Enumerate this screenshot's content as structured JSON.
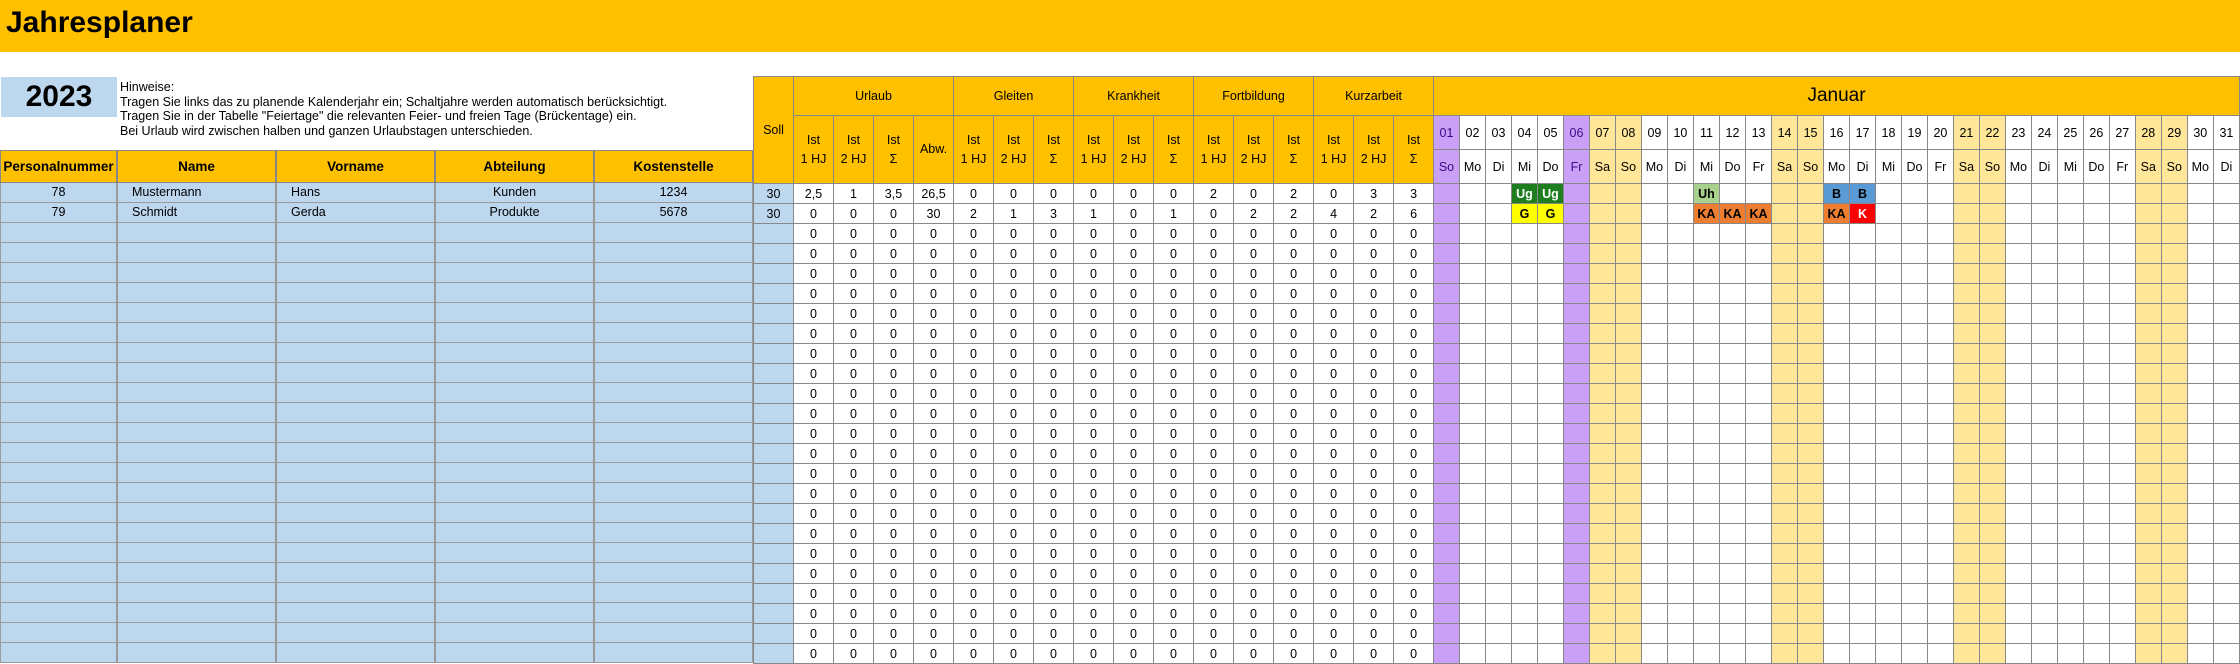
{
  "title": "Jahresplaner",
  "year": "2023",
  "notes": [
    "Hinweise:",
    "Tragen Sie links das zu planende Kalenderjahr ein; Schaltjahre werden automatisch berücksichtigt.",
    "Tragen Sie in der Tabelle \"Feiertage\" die relevanten Feier- und freien Tage (Brückentage) ein.",
    "Bei Urlaub wird zwischen halben und ganzen Urlaubstagen unterschieden."
  ],
  "employee_headers": [
    "Personalnummer",
    "Name",
    "Vorname",
    "Abteilung",
    "Kostenstelle"
  ],
  "employees": [
    {
      "nr": "78",
      "name": "Mustermann",
      "vorname": "Hans",
      "abteilung": "Kunden",
      "kst": "1234"
    },
    {
      "nr": "79",
      "name": "Schmidt",
      "vorname": "Gerda",
      "abteilung": "Produkte",
      "kst": "5678"
    }
  ],
  "total_rows": 24,
  "soll_label": "Soll",
  "groups": [
    "Urlaub",
    "Gleiten",
    "Krankheit",
    "Fortbildung",
    "Kurzarbeit"
  ],
  "urlaub_subs": [
    "Ist\n1 HJ",
    "Ist\n2 HJ",
    "Ist\nΣ",
    "Abw."
  ],
  "other_subs": [
    "Ist\n1 HJ",
    "Ist\n2 HJ",
    "Ist\nΣ"
  ],
  "stats_rows": [
    {
      "soll": "30",
      "values": [
        "2,5",
        "1",
        "3,5",
        "26,5",
        "0",
        "0",
        "0",
        "0",
        "0",
        "0",
        "2",
        "0",
        "2",
        "0",
        "3",
        "3"
      ]
    },
    {
      "soll": "30",
      "values": [
        "0",
        "0",
        "0",
        "30",
        "2",
        "1",
        "3",
        "1",
        "0",
        "1",
        "0",
        "2",
        "2",
        "4",
        "2",
        "6"
      ]
    }
  ],
  "zero_value": "0",
  "month": "Januar",
  "days": [
    {
      "num": "01",
      "name": "So",
      "type": "hol"
    },
    {
      "num": "02",
      "name": "Mo",
      "type": ""
    },
    {
      "num": "03",
      "name": "Di",
      "type": ""
    },
    {
      "num": "04",
      "name": "Mi",
      "type": ""
    },
    {
      "num": "05",
      "name": "Do",
      "type": ""
    },
    {
      "num": "06",
      "name": "Fr",
      "type": "hol"
    },
    {
      "num": "07",
      "name": "Sa",
      "type": "we"
    },
    {
      "num": "08",
      "name": "So",
      "type": "we"
    },
    {
      "num": "09",
      "name": "Mo",
      "type": ""
    },
    {
      "num": "10",
      "name": "Di",
      "type": ""
    },
    {
      "num": "11",
      "name": "Mi",
      "type": ""
    },
    {
      "num": "12",
      "name": "Do",
      "type": ""
    },
    {
      "num": "13",
      "name": "Fr",
      "type": ""
    },
    {
      "num": "14",
      "name": "Sa",
      "type": "we"
    },
    {
      "num": "15",
      "name": "So",
      "type": "we"
    },
    {
      "num": "16",
      "name": "Mo",
      "type": ""
    },
    {
      "num": "17",
      "name": "Di",
      "type": ""
    },
    {
      "num": "18",
      "name": "Mi",
      "type": ""
    },
    {
      "num": "19",
      "name": "Do",
      "type": ""
    },
    {
      "num": "20",
      "name": "Fr",
      "type": ""
    },
    {
      "num": "21",
      "name": "Sa",
      "type": "we"
    },
    {
      "num": "22",
      "name": "So",
      "type": "we"
    },
    {
      "num": "23",
      "name": "Mo",
      "type": ""
    },
    {
      "num": "24",
      "name": "Di",
      "type": ""
    },
    {
      "num": "25",
      "name": "Mi",
      "type": ""
    },
    {
      "num": "26",
      "name": "Do",
      "type": ""
    },
    {
      "num": "27",
      "name": "Fr",
      "type": ""
    },
    {
      "num": "28",
      "name": "Sa",
      "type": "we"
    },
    {
      "num": "29",
      "name": "So",
      "type": "we"
    },
    {
      "num": "30",
      "name": "Mo",
      "type": ""
    },
    {
      "num": "31",
      "name": "Di",
      "type": ""
    }
  ],
  "entries": [
    {
      "row": 0,
      "day": 4,
      "code": "Ug",
      "bg": "#1e7d1e",
      "fg": "#ffffff"
    },
    {
      "row": 0,
      "day": 5,
      "code": "Ug",
      "bg": "#1e7d1e",
      "fg": "#ffffff"
    },
    {
      "row": 0,
      "day": 11,
      "code": "Uh",
      "bg": "#a9d18e",
      "fg": "#000000"
    },
    {
      "row": 0,
      "day": 16,
      "code": "B",
      "bg": "#5b9bd5",
      "fg": "#000000"
    },
    {
      "row": 0,
      "day": 17,
      "code": "B",
      "bg": "#5b9bd5",
      "fg": "#000000"
    },
    {
      "row": 1,
      "day": 4,
      "code": "G",
      "bg": "#ffff00",
      "fg": "#000000"
    },
    {
      "row": 1,
      "day": 5,
      "code": "G",
      "bg": "#ffff00",
      "fg": "#000000"
    },
    {
      "row": 1,
      "day": 11,
      "code": "KA",
      "bg": "#ed7d31",
      "fg": "#000000"
    },
    {
      "row": 1,
      "day": 12,
      "code": "KA",
      "bg": "#ed7d31",
      "fg": "#000000"
    },
    {
      "row": 1,
      "day": 13,
      "code": "KA",
      "bg": "#ed7d31",
      "fg": "#000000"
    },
    {
      "row": 1,
      "day": 16,
      "code": "KA",
      "bg": "#ed7d31",
      "fg": "#000000"
    },
    {
      "row": 1,
      "day": 17,
      "code": "K",
      "bg": "#ff0000",
      "fg": "#ffffff"
    }
  ],
  "colors": {
    "accent": "#ffc000",
    "employee_bg": "#bdd7ee",
    "weekend": "#ffe699",
    "holiday": "#c9a0f5"
  }
}
